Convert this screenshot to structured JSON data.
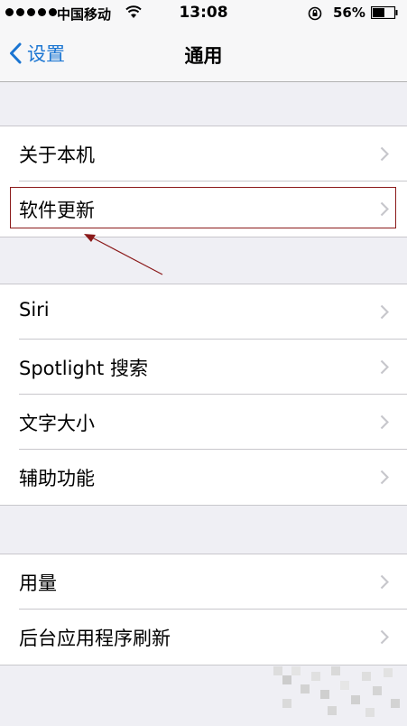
{
  "status_bar": {
    "carrier": "中国移动",
    "time": "13:08",
    "battery_percent": "56%",
    "battery_level": 0.56,
    "icons": [
      "signal-dots-icon",
      "wifi-icon",
      "rotation-lock-icon",
      "battery-icon"
    ]
  },
  "nav": {
    "back_label": "设置",
    "title": "通用",
    "back_icon": "chevron-left-icon"
  },
  "sections": [
    {
      "items": [
        {
          "label": "关于本机"
        },
        {
          "label": "软件更新"
        }
      ]
    },
    {
      "items": [
        {
          "label": "Siri"
        },
        {
          "label": "Spotlight 搜索"
        },
        {
          "label": "文字大小"
        },
        {
          "label": "辅助功能"
        }
      ]
    },
    {
      "items": [
        {
          "label": "用量"
        },
        {
          "label": "后台应用程序刷新"
        }
      ]
    }
  ],
  "annotation": {
    "highlighted_item": "软件更新",
    "color": "#8b1a1a"
  },
  "colors": {
    "accent": "#1a75d2",
    "background": "#efeff4",
    "separator": "#c8c7cc"
  }
}
